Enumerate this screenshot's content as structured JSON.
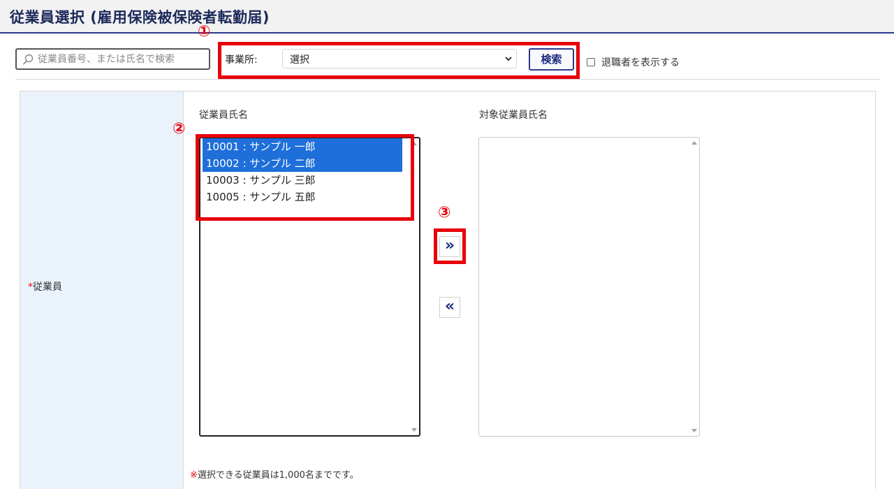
{
  "header": {
    "title": "従業員選択 (雇用保険被保険者転勤届)"
  },
  "search": {
    "placeholder": "従業員番号、または氏名で検索"
  },
  "office": {
    "label": "事業所:",
    "selected": "選択"
  },
  "search_button": "検索",
  "retired_checkbox": {
    "label": "退職者を表示する",
    "checked": false
  },
  "annotations": [
    "①",
    "②",
    "③"
  ],
  "field": {
    "required_mark": "*",
    "label": "従業員"
  },
  "source_list": {
    "title": "従業員氏名",
    "items": [
      {
        "label": "10001 : サンプル 一郎",
        "selected": true
      },
      {
        "label": "10002 : サンプル 二郎",
        "selected": true
      },
      {
        "label": "10003 : サンプル 三郎",
        "selected": false
      },
      {
        "label": "10005 : サンプル 五郎",
        "selected": false
      }
    ]
  },
  "target_list": {
    "title": "対象従業員氏名",
    "items": []
  },
  "buttons": {
    "add": "»",
    "remove": "«"
  },
  "note": {
    "mark": "※",
    "text": "選択できる従業員は1,000名までです。"
  },
  "colors": {
    "highlight": "#e8000b",
    "selection": "#1e6fd9",
    "accent": "#2b3a8c",
    "label_panel": "#eaf3fc"
  }
}
